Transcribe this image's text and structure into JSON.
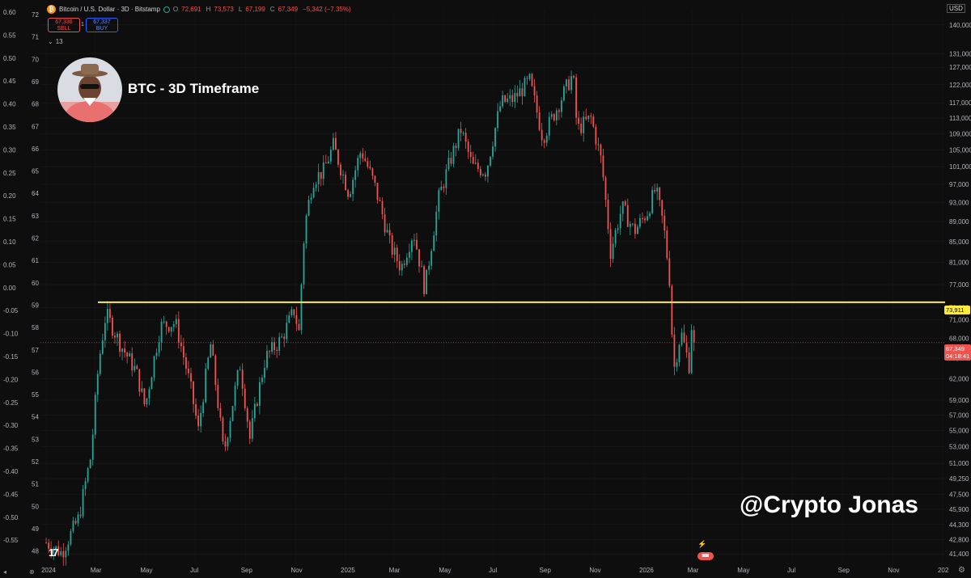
{
  "header": {
    "btc_icon": "₿",
    "symbol": "Bitcoin / U.S. Dollar · 3D · Bitstamp",
    "open_label": "O",
    "open": "72,691",
    "high_label": "H",
    "high": "73,573",
    "low_label": "L",
    "low": "67,199",
    "close_label": "C",
    "close": "67,349",
    "change": "−5,342 (−7.35%)"
  },
  "trade": {
    "sell_price": "67,336",
    "sell_label": "SELL",
    "spread": "1",
    "buy_price": "67,337",
    "buy_label": "BUY"
  },
  "indicator_count": "13",
  "overlay_title": "BTC - 3D Timeframe",
  "watermark": "@Crypto Jonas",
  "currency": "USD",
  "level_tag": "73,911",
  "price_tag": "67,349",
  "countdown": "04:18:41",
  "event_badge": "⚡",
  "colors": {
    "up": "#26a69a",
    "down": "#ef5350",
    "level": "#ffeb3b",
    "background": "#0e0e0e"
  },
  "chart_data": {
    "type": "candlestick",
    "right_ticks": [
      "140,000",
      "131,000",
      "127,000",
      "122,000",
      "117,000",
      "113,000",
      "109,000",
      "105,000",
      "101,000",
      "97,000",
      "93,000",
      "89,000",
      "85,000",
      "81,000",
      "77,000",
      "73,000",
      "71,000",
      "68,000",
      "65,000",
      "62,000",
      "59,000",
      "57,000",
      "55,000",
      "53,000",
      "51,000",
      "49,250",
      "47,500",
      "45,900",
      "44,300",
      "42,800",
      "41,400"
    ],
    "left_ticks_a": [
      "0.60",
      "0.55",
      "0.50",
      "0.45",
      "0.40",
      "0.35",
      "0.30",
      "0.25",
      "0.20",
      "0.15",
      "0.10",
      "0.05",
      "0.00",
      "-0.05",
      "-0.10",
      "-0.15",
      "-0.20",
      "-0.25",
      "-0.30",
      "-0.35",
      "-0.40",
      "-0.45",
      "-0.50",
      "-0.55"
    ],
    "left_ticks_b": [
      "72",
      "71",
      "70",
      "69",
      "68",
      "67",
      "66",
      "65",
      "64",
      "63",
      "62",
      "61",
      "60",
      "59",
      "58",
      "57",
      "56",
      "55",
      "54",
      "53",
      "52",
      "51",
      "50",
      "49",
      "48"
    ],
    "x_ticks": [
      "2024",
      "Mar",
      "May",
      "Jul",
      "Sep",
      "Nov",
      "2025",
      "Mar",
      "May",
      "Jul",
      "Sep",
      "Nov",
      "2026",
      "Mar",
      "May",
      "Jul",
      "Sep",
      "Nov",
      "202"
    ],
    "horizontal_level": 73911,
    "last_price": 67349,
    "anchors": [
      [
        "2024-01-01",
        42500
      ],
      [
        "2024-01-20",
        41500
      ],
      [
        "2024-02-10",
        45000
      ],
      [
        "2024-02-25",
        52000
      ],
      [
        "2024-03-05",
        64000
      ],
      [
        "2024-03-14",
        72000
      ],
      [
        "2024-04-01",
        67000
      ],
      [
        "2024-04-20",
        63000
      ],
      [
        "2024-05-01",
        58000
      ],
      [
        "2024-05-20",
        70000
      ],
      [
        "2024-06-07",
        70500
      ],
      [
        "2024-06-25",
        61000
      ],
      [
        "2024-07-05",
        55000
      ],
      [
        "2024-07-20",
        67000
      ],
      [
        "2024-08-05",
        52000
      ],
      [
        "2024-08-25",
        64000
      ],
      [
        "2024-09-06",
        54000
      ],
      [
        "2024-09-25",
        65000
      ],
      [
        "2024-10-15",
        68000
      ],
      [
        "2024-10-30",
        72500
      ],
      [
        "2024-11-05",
        69000
      ],
      [
        "2024-11-12",
        88000
      ],
      [
        "2024-11-22",
        98000
      ],
      [
        "2024-12-05",
        100000
      ],
      [
        "2024-12-17",
        106000
      ],
      [
        "2025-01-05",
        95000
      ],
      [
        "2025-01-20",
        105000
      ],
      [
        "2025-02-05",
        97000
      ],
      [
        "2025-02-25",
        84000
      ],
      [
        "2025-03-10",
        80000
      ],
      [
        "2025-03-25",
        87000
      ],
      [
        "2025-04-08",
        76000
      ],
      [
        "2025-04-25",
        94000
      ],
      [
        "2025-05-10",
        103000
      ],
      [
        "2025-05-22",
        110000
      ],
      [
        "2025-06-05",
        101000
      ],
      [
        "2025-06-22",
        100000
      ],
      [
        "2025-07-10",
        117000
      ],
      [
        "2025-07-25",
        118000
      ],
      [
        "2025-08-14",
        123000
      ],
      [
        "2025-08-30",
        108000
      ],
      [
        "2025-09-15",
        115000
      ],
      [
        "2025-10-06",
        125000
      ],
      [
        "2025-10-11",
        110000
      ],
      [
        "2025-10-28",
        113000
      ],
      [
        "2025-11-10",
        102000
      ],
      [
        "2025-11-21",
        83000
      ],
      [
        "2025-12-05",
        92000
      ],
      [
        "2025-12-20",
        87000
      ],
      [
        "2026-01-05",
        91000
      ],
      [
        "2026-01-15",
        96000
      ],
      [
        "2026-01-25",
        88000
      ],
      [
        "2026-02-01",
        78000
      ],
      [
        "2026-02-06",
        63000
      ],
      [
        "2026-02-15",
        69000
      ],
      [
        "2026-02-25",
        64000
      ],
      [
        "2026-03-01",
        72000
      ],
      [
        "2026-03-04",
        67349
      ]
    ]
  }
}
